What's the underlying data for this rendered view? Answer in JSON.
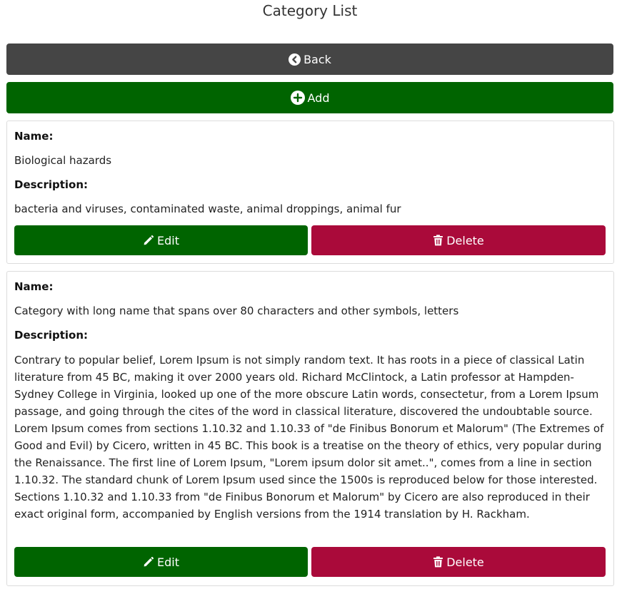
{
  "page": {
    "title": "Category List"
  },
  "toolbar": {
    "back_label": "Back",
    "add_label": "Add"
  },
  "labels": {
    "name": "Name:",
    "description": "Description:"
  },
  "categories": [
    {
      "name": "Biological hazards",
      "description": "bacteria and viruses, contaminated waste, animal droppings, animal fur",
      "edit_label": "Edit",
      "delete_label": "Delete"
    },
    {
      "name": "Category with long name that spans over 80 characters and other symbols, letters",
      "description": "Contrary to popular belief, Lorem Ipsum is not simply random text. It has roots in a piece of classical Latin literature from 45 BC, making it over 2000 years old. Richard McClintock, a Latin professor at Hampden-Sydney College in Virginia, looked up one of the more obscure Latin words, consectetur, from a Lorem Ipsum passage, and going through the cites of the word in classical literature, discovered the undoubtable source. Lorem Ipsum comes from sections 1.10.32 and 1.10.33 of \"de Finibus Bonorum et Malorum\" (The Extremes of Good and Evil) by Cicero, written in 45 BC. This book is a treatise on the theory of ethics, very popular during the Renaissance. The first line of Lorem Ipsum, \"Lorem ipsum dolor sit amet..\", comes from a line in section 1.10.32. The standard chunk of Lorem Ipsum used since the 1500s is reproduced below for those interested. Sections 1.10.32 and 1.10.33 from \"de Finibus Bonorum et Malorum\" by Cicero are also reproduced in their exact original form, accompanied by English versions from the 1914 translation by H. Rackham.",
      "edit_label": "Edit",
      "delete_label": "Delete"
    }
  ],
  "icons": {
    "back": "chevron-circle-left-icon",
    "add": "plus-circle-icon",
    "edit": "pencil-icon",
    "delete": "trash-icon"
  },
  "colors": {
    "back_button": "#454545",
    "add_button": "#006400",
    "edit_button": "#006400",
    "delete_button": "#aa0a3a"
  }
}
